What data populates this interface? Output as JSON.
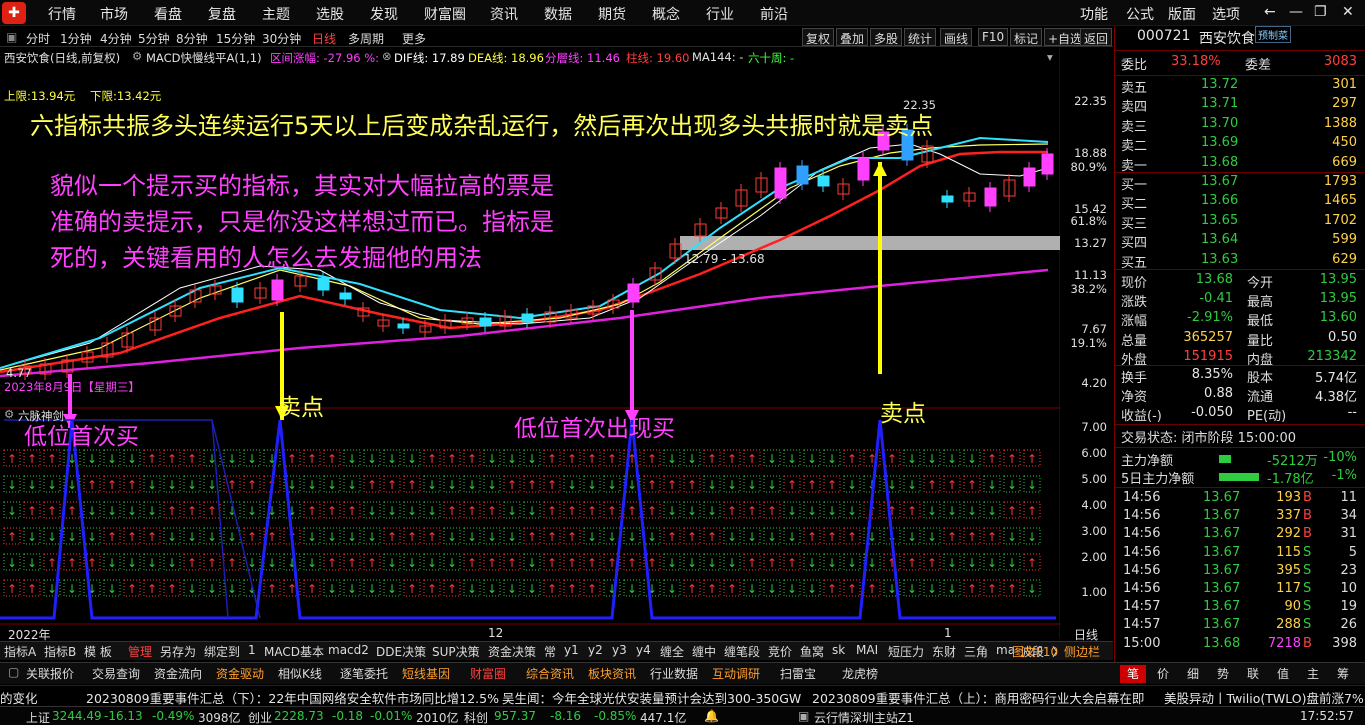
{
  "menu": {
    "items": [
      "行情",
      "市场",
      "看盘",
      "复盘",
      "主题",
      "选股",
      "发现",
      "财富圈",
      "资讯",
      "数据",
      "期货",
      "概念",
      "行业",
      "前沿"
    ],
    "right": [
      "功能",
      "公式",
      "版面",
      "选项"
    ]
  },
  "periods": {
    "items": [
      "分时",
      "1分钟",
      "4分钟",
      "5分钟",
      "8分钟",
      "15分钟",
      "30分钟",
      "日线",
      "多周期",
      "更多"
    ],
    "active": "日线"
  },
  "tools": [
    "复权",
    "叠加",
    "多股",
    "统计",
    "画线",
    "F10",
    "标记",
    "+自选",
    "返回"
  ],
  "chart_header": {
    "stock": "西安饮食(日线,前复权)",
    "macd_label": "MACD快慢线平A(1,1)",
    "range_label": "区间涨幅: -27.96 %:",
    "dif": "DIF线: 17.89",
    "dea": "DEA线: 18.96",
    "fen": "分層线: 11.46",
    "zhu": "柱线: 19.60",
    "ma144": "MA144: -",
    "liushi": "六十周: -"
  },
  "limits": {
    "upper": "上限:13.94元",
    "lower": "下限:13.42元"
  },
  "annotations": {
    "headline": "六指标共振多头连续运行5天以上后变成杂乱运行，然后再次出现多头共振时就是卖点",
    "desc1": "貌似一个提示买的指标，其实对大幅拉高的票是",
    "desc2": "准确的卖提示，只是你没这样想过而已。指标是",
    "desc3": "死的，关键看用的人怎么去发掘他的用法",
    "buy1": "低位首次买",
    "sell1": "卖点",
    "buy2": "低位首次出现买",
    "sell2": "卖点",
    "band": "12.79 - 13.68",
    "peak": "22.35",
    "low_mark": "4.77",
    "date_mark": "2023年8月9日【星期三】"
  },
  "price_axis": [
    "22.35",
    "18.88",
    "80.9%",
    "15.42",
    "61.8%",
    "13.27",
    "11.13",
    "38.2%",
    "7.67",
    "19.1%",
    "4.20"
  ],
  "indicator": {
    "name": "六脉神剑",
    "axis": [
      "7.00",
      "6.00",
      "5.00",
      "4.00",
      "3.00",
      "2.00",
      "1.00"
    ]
  },
  "time_axis": {
    "left": "2022年",
    "mid": "12",
    "right": "1",
    "unit": "日线"
  },
  "quote": {
    "code": "000721",
    "name": "西安饮食",
    "badge": "预制菜",
    "weibi_l": "委比",
    "weibi": "33.18%",
    "weicha_l": "委差",
    "weicha": "3083",
    "sells": [
      [
        "卖五",
        "13.72",
        "301"
      ],
      [
        "卖四",
        "13.71",
        "297"
      ],
      [
        "卖三",
        "13.70",
        "1388"
      ],
      [
        "卖二",
        "13.69",
        "450"
      ],
      [
        "卖一",
        "13.68",
        "669"
      ]
    ],
    "buys": [
      [
        "买一",
        "13.67",
        "1793"
      ],
      [
        "买二",
        "13.66",
        "1465"
      ],
      [
        "买三",
        "13.65",
        "1702"
      ],
      [
        "买四",
        "13.64",
        "599"
      ],
      [
        "买五",
        "13.63",
        "629"
      ]
    ],
    "stats": [
      [
        "现价",
        "13.68",
        "今开",
        "13.95"
      ],
      [
        "涨跌",
        "-0.41",
        "最高",
        "13.95"
      ],
      [
        "涨幅",
        "-2.91%",
        "最低",
        "13.60"
      ],
      [
        "总量",
        "365257",
        "量比",
        "0.50"
      ],
      [
        "外盘",
        "151915",
        "内盘",
        "213342"
      ]
    ],
    "stats2": [
      [
        "换手",
        "8.35%",
        "股本",
        "5.74亿"
      ],
      [
        "净资",
        "0.88",
        "流通",
        "4.38亿"
      ],
      [
        "收益(-)",
        "-0.050",
        "PE(动)",
        "--"
      ]
    ],
    "trade_state": "交易状态: 闭市阶段 15:00:00",
    "flow": [
      [
        "主力净额",
        "-5212万",
        "-10%"
      ],
      [
        "5日主力净额",
        "-1.78亿",
        "-1%"
      ]
    ],
    "ticks": [
      [
        "14:56",
        "13.67",
        "193",
        "B",
        "11"
      ],
      [
        "14:56",
        "13.67",
        "337",
        "B",
        "34"
      ],
      [
        "14:56",
        "13.67",
        "292",
        "B",
        "31"
      ],
      [
        "14:56",
        "13.67",
        "115",
        "S",
        "5"
      ],
      [
        "14:56",
        "13.67",
        "395",
        "S",
        "23"
      ],
      [
        "14:56",
        "13.67",
        "117",
        "S",
        "10"
      ],
      [
        "14:57",
        "13.67",
        "90",
        "S",
        "19"
      ],
      [
        "14:57",
        "13.67",
        "288",
        "S",
        "26"
      ],
      [
        "15:00",
        "13.68",
        "7218",
        "B",
        "398"
      ]
    ]
  },
  "toolbar1": [
    "指标A",
    "指标B",
    "模 板",
    "管理",
    "另存为",
    "绑定到",
    "1",
    "MACD基本",
    "macd2",
    "DDE决策",
    "SUP决策",
    "资金决策",
    "常",
    "y1",
    "y2",
    "y3",
    "y4",
    "缠全",
    "缠中",
    "缠笔段",
    "竞价",
    "鱼窝",
    "sk",
    "MAI",
    "短压力",
    "东财",
    "三角",
    "ma",
    "波段",
    "〉",
    "图文F10",
    "侧边栏"
  ],
  "toolbar2": [
    "关联报价",
    "交易查询",
    "资金流向",
    "资金驱动",
    "相似K线",
    "逐笔委托",
    "短线基因",
    "财富圈",
    "综合资讯",
    "板块资讯",
    "行业数据",
    "互动调研",
    "扫雷宝",
    "龙虎榜"
  ],
  "toolbar2_right": [
    "笔",
    "价",
    "细",
    "势",
    "联",
    "值",
    "主",
    "筹"
  ],
  "news": [
    "的变化",
    "20230809重要事件汇总（下）：22年中国网络安全软件市场同比增12.5%",
    "吴生闻：今年全球光伏安装量预计会达到300-350GW",
    "20230809重要事件汇总（上）：商用密码行业大会启幕在即",
    "美股异动丨Twilio(TWLO)盘前涨7% C"
  ],
  "status": {
    "sh_l": "上证",
    "sh": "3244.49",
    "sh_c": "-16.13",
    "sh_p": "-0.49%",
    "sh_v": "3098亿",
    "cy_l": "创业",
    "cy": "2228.73",
    "cy_c": "-0.18",
    "cy_p": "-0.01%",
    "cy_v": "2010亿",
    "kc_l": "科创",
    "kc": "957.37",
    "kc_c": "-8.16",
    "kc_p": "-0.85%",
    "kc_v": "447.1亿",
    "server": "云行情深圳主站Z1",
    "time": "17:52:57"
  },
  "colors": {
    "up": "#ff3b3b",
    "down": "#2ecc40",
    "band": "#b0b0b0",
    "headline": "#ffff55",
    "desc": "#ff40ff",
    "arrow_sell": "#ffff00",
    "arrow_buy": "#ff40ff",
    "indicator_line": "#2020ff"
  }
}
